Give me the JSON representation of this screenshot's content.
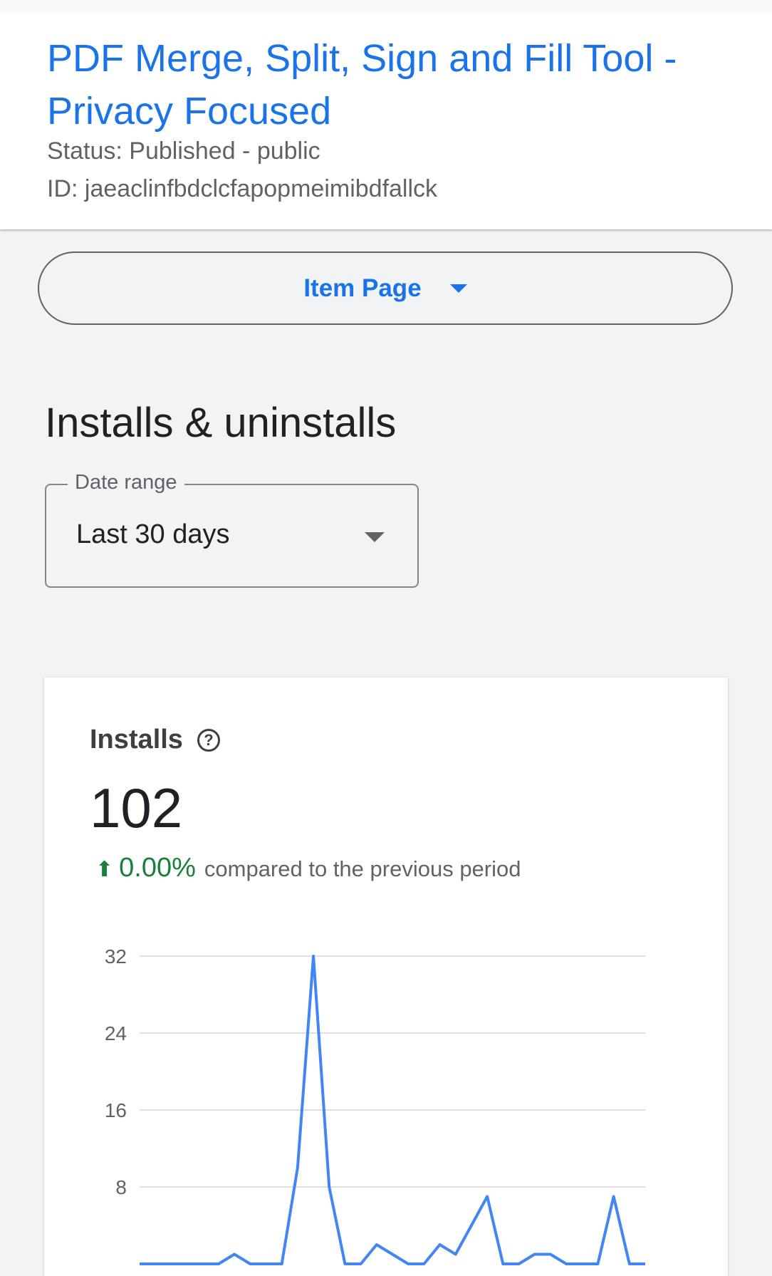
{
  "header": {
    "title": "PDF Merge, Split, Sign and Fill Tool - Privacy Focused",
    "status": "Status: Published - public",
    "id": "ID: jaeaclinfbdclcfapopmeimibdfallck"
  },
  "page_selector": {
    "label": "Item Page"
  },
  "section": {
    "heading": "Installs & uninstalls"
  },
  "date_range": {
    "legend": "Date range",
    "value": "Last 30 days"
  },
  "installs_card": {
    "title": "Installs",
    "help_icon": "help-circle-icon",
    "value": "102",
    "change": "0.00%",
    "change_direction": "up",
    "comparison_text": "compared to the previous period"
  },
  "colors": {
    "accent": "#1a73e8",
    "positive": "#188038",
    "line": "#4285f4"
  },
  "chart_data": {
    "type": "line",
    "title": "",
    "xlabel": "",
    "ylabel": "",
    "ylim": [
      0,
      32
    ],
    "y_ticks": [
      8,
      16,
      24,
      32
    ],
    "grid": true,
    "series": [
      {
        "values": [
          0,
          0,
          0,
          0,
          0,
          0,
          1,
          0,
          0,
          0,
          10,
          32,
          8,
          0,
          0,
          2,
          1,
          0,
          0,
          2,
          1,
          4,
          7,
          0,
          0,
          1,
          1,
          0,
          0,
          0,
          7,
          0,
          0
        ]
      }
    ]
  }
}
